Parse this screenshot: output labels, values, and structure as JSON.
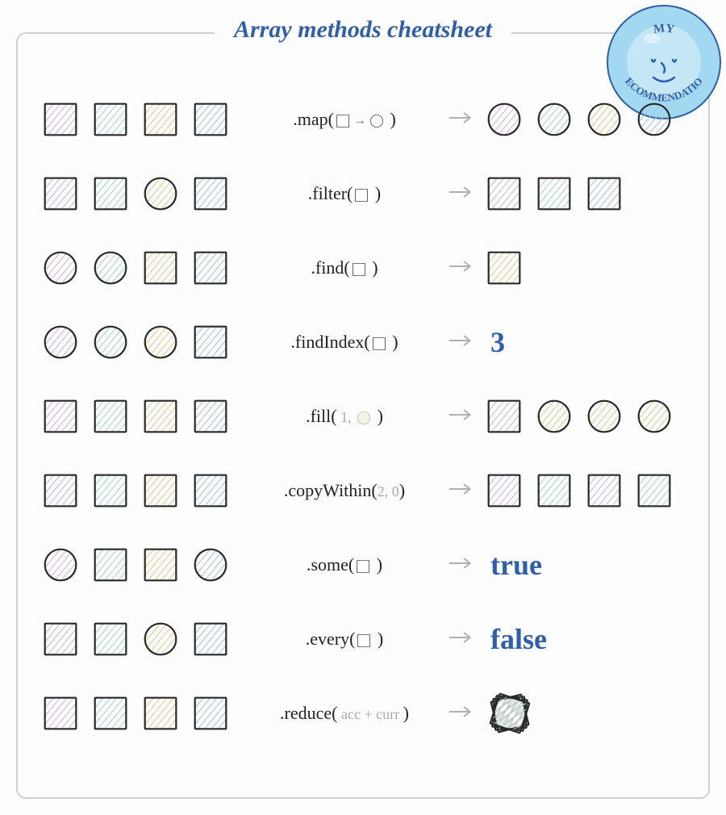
{
  "title": "Array methods cheatsheet",
  "badge": {
    "top": "MY",
    "bottom": "RECOMMENDATION"
  },
  "colors": {
    "purple": "#c9b3e0",
    "teal": "#a0d4ce",
    "tan": "#e0c98a",
    "blue": "#a5c2d9",
    "green": "#c0d88a",
    "stroke": "#2a2a2a",
    "faded": "#aaaaaa"
  },
  "rows": [
    {
      "id": "map",
      "input": [
        {
          "shape": "square",
          "color": "purple"
        },
        {
          "shape": "square",
          "color": "teal"
        },
        {
          "shape": "square",
          "color": "tan"
        },
        {
          "shape": "square",
          "color": "blue"
        }
      ],
      "method": {
        "prefix": ".map(",
        "inline": [
          {
            "t": "shape",
            "shape": "square"
          },
          {
            "t": "arrow"
          },
          {
            "t": "shape",
            "shape": "circle"
          }
        ],
        "suffix": " )"
      },
      "output": [
        {
          "shape": "circle",
          "color": "purple"
        },
        {
          "shape": "circle",
          "color": "teal"
        },
        {
          "shape": "circle",
          "color": "tan"
        },
        {
          "shape": "circle",
          "color": "blue"
        }
      ]
    },
    {
      "id": "filter",
      "input": [
        {
          "shape": "square",
          "color": "purple"
        },
        {
          "shape": "square",
          "color": "teal"
        },
        {
          "shape": "circle",
          "color": "tan"
        },
        {
          "shape": "square",
          "color": "blue"
        }
      ],
      "method": {
        "prefix": ".filter(",
        "inline": [
          {
            "t": "shape",
            "shape": "square"
          }
        ],
        "suffix": " )"
      },
      "output": [
        {
          "shape": "square",
          "color": "purple"
        },
        {
          "shape": "square",
          "color": "teal"
        },
        {
          "shape": "square",
          "color": "blue"
        }
      ]
    },
    {
      "id": "find",
      "input": [
        {
          "shape": "circle",
          "color": "purple"
        },
        {
          "shape": "circle",
          "color": "teal"
        },
        {
          "shape": "square",
          "color": "tan"
        },
        {
          "shape": "square",
          "color": "blue"
        }
      ],
      "method": {
        "prefix": ".find(",
        "inline": [
          {
            "t": "shape",
            "shape": "square"
          }
        ],
        "suffix": " )"
      },
      "output": [
        {
          "shape": "square",
          "color": "tan"
        }
      ]
    },
    {
      "id": "findIndex",
      "input": [
        {
          "shape": "circle",
          "color": "purple"
        },
        {
          "shape": "circle",
          "color": "teal"
        },
        {
          "shape": "circle",
          "color": "tan"
        },
        {
          "shape": "square",
          "color": "blue"
        }
      ],
      "method": {
        "prefix": ".findIndex(",
        "inline": [
          {
            "t": "shape",
            "shape": "square"
          }
        ],
        "suffix": " )"
      },
      "result_text": "3"
    },
    {
      "id": "fill",
      "input": [
        {
          "shape": "square",
          "color": "purple"
        },
        {
          "shape": "square",
          "color": "teal"
        },
        {
          "shape": "square",
          "color": "tan"
        },
        {
          "shape": "square",
          "color": "blue"
        }
      ],
      "method": {
        "prefix": ".fill(",
        "inline": [
          {
            "t": "text",
            "text": " 1, ",
            "faded": true
          },
          {
            "t": "shape",
            "shape": "circle",
            "faded": true,
            "color": "green"
          }
        ],
        "suffix": " )"
      },
      "output": [
        {
          "shape": "square",
          "color": "purple"
        },
        {
          "shape": "circle",
          "color": "green"
        },
        {
          "shape": "circle",
          "color": "green"
        },
        {
          "shape": "circle",
          "color": "green"
        }
      ]
    },
    {
      "id": "copyWithin",
      "input": [
        {
          "shape": "square",
          "color": "purple"
        },
        {
          "shape": "square",
          "color": "teal"
        },
        {
          "shape": "square",
          "color": "tan"
        },
        {
          "shape": "square",
          "color": "blue"
        }
      ],
      "method": {
        "prefix": ".copyWithin(",
        "inline": [
          {
            "t": "text",
            "text": "2, 0",
            "faded": true
          }
        ],
        "suffix": ")"
      },
      "output": [
        {
          "shape": "square",
          "color": "purple"
        },
        {
          "shape": "square",
          "color": "teal"
        },
        {
          "shape": "square",
          "color": "purple"
        },
        {
          "shape": "square",
          "color": "teal"
        }
      ]
    },
    {
      "id": "some",
      "input": [
        {
          "shape": "circle",
          "color": "purple"
        },
        {
          "shape": "square",
          "color": "teal"
        },
        {
          "shape": "square",
          "color": "tan"
        },
        {
          "shape": "circle",
          "color": "blue"
        }
      ],
      "method": {
        "prefix": ".some(",
        "inline": [
          {
            "t": "shape",
            "shape": "square"
          }
        ],
        "suffix": " )"
      },
      "result_text": "true"
    },
    {
      "id": "every",
      "input": [
        {
          "shape": "square",
          "color": "purple"
        },
        {
          "shape": "square",
          "color": "teal"
        },
        {
          "shape": "circle",
          "color": "tan"
        },
        {
          "shape": "square",
          "color": "blue"
        }
      ],
      "method": {
        "prefix": ".every(",
        "inline": [
          {
            "t": "shape",
            "shape": "square"
          }
        ],
        "suffix": " )"
      },
      "result_text": "false"
    },
    {
      "id": "reduce",
      "input": [
        {
          "shape": "square",
          "color": "purple"
        },
        {
          "shape": "square",
          "color": "teal"
        },
        {
          "shape": "square",
          "color": "tan"
        },
        {
          "shape": "square",
          "color": "blue"
        }
      ],
      "method": {
        "prefix": ".reduce(",
        "inline": [
          {
            "t": "text",
            "text": " acc + curr ",
            "faded": true
          }
        ],
        "suffix": ")"
      },
      "stacked_output": true
    }
  ]
}
